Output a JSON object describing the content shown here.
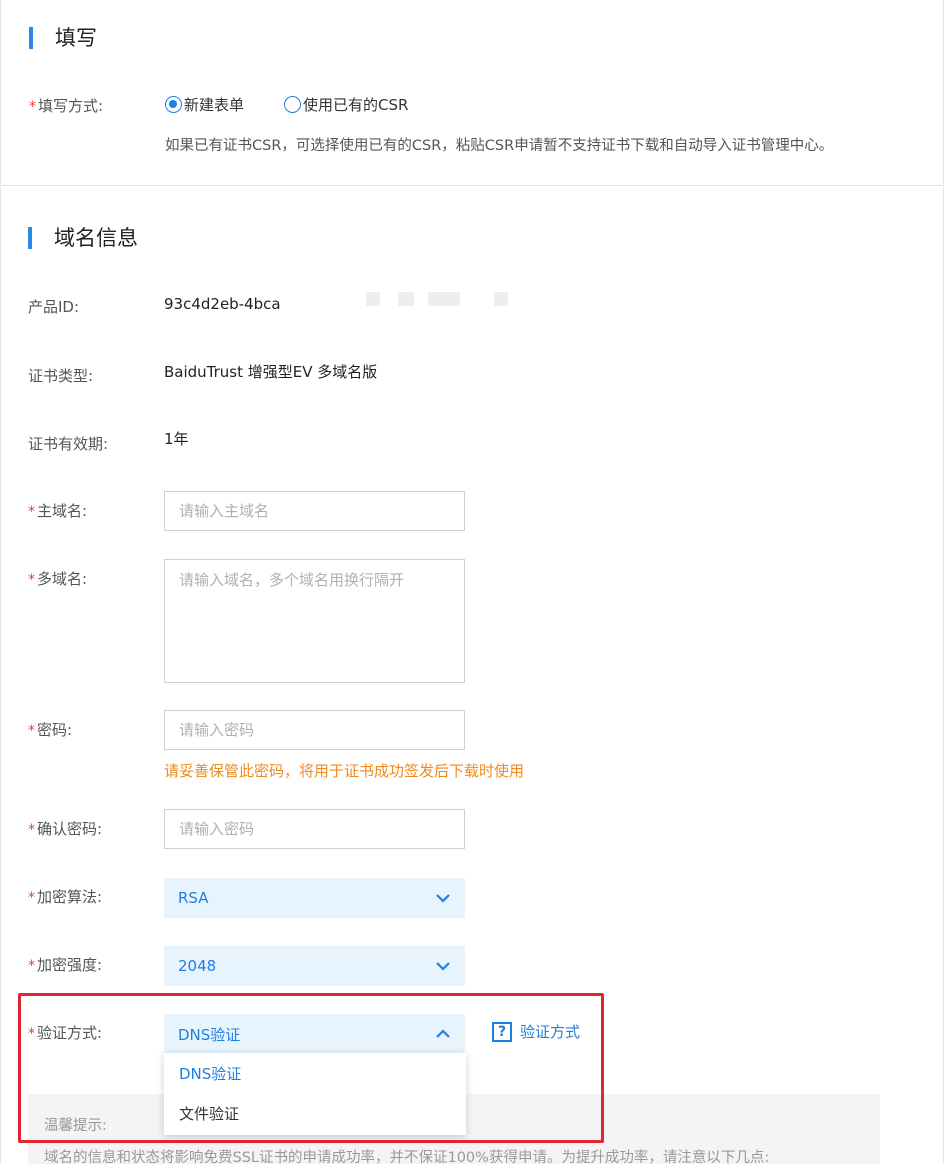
{
  "section_fill": {
    "title": "填写",
    "method_label": "填写方式:",
    "options": [
      "新建表单",
      "使用已有的CSR"
    ],
    "selected_index": 0,
    "hint": "如果已有证书CSR，可选择使用已有的CSR，粘贴CSR申请暂不支持证书下载和自动导入证书管理中心。"
  },
  "section_domain": {
    "title": "域名信息",
    "product_id_label": "产品ID:",
    "product_id_value": "93c4d2eb-4bca",
    "cert_type_label": "证书类型:",
    "cert_type_value": "BaiduTrust 增强型EV 多域名版",
    "validity_label": "证书有效期:",
    "validity_value": "1年",
    "main_domain_label": "主域名:",
    "main_domain_placeholder": "请输入主域名",
    "multi_domain_label": "多域名:",
    "multi_domain_placeholder": "请输入域名，多个域名用换行隔开",
    "password_label": "密码:",
    "password_placeholder": "请输入密码",
    "password_warning": "请妥善保管此密码，将用于证书成功签发后下载时使用",
    "confirm_password_label": "确认密码:",
    "confirm_password_placeholder": "请输入密码",
    "algorithm_label": "加密算法:",
    "algorithm_value": "RSA",
    "strength_label": "加密强度:",
    "strength_value": "2048",
    "verify_label": "验证方式:",
    "verify_value": "DNS验证",
    "verify_help": "验证方式",
    "verify_options": [
      "DNS验证",
      "文件验证"
    ],
    "tip_title": "温馨提示:",
    "tip_text": "域名的信息和状态将影响免费SSL证书的申请成功率，并不保证100%获得申请。为提升成功率，请注意以下几点:"
  },
  "colors": {
    "accent": "#1f7fe0",
    "required_star": "#e0412f",
    "warning": "#f08a1c",
    "highlight_border": "#e02533",
    "select_bg": "#e8f4fd"
  },
  "icons": {
    "required": "asterisk",
    "caret_down": "chevron-down-icon",
    "caret_up": "chevron-up-icon",
    "help": "question-icon"
  }
}
